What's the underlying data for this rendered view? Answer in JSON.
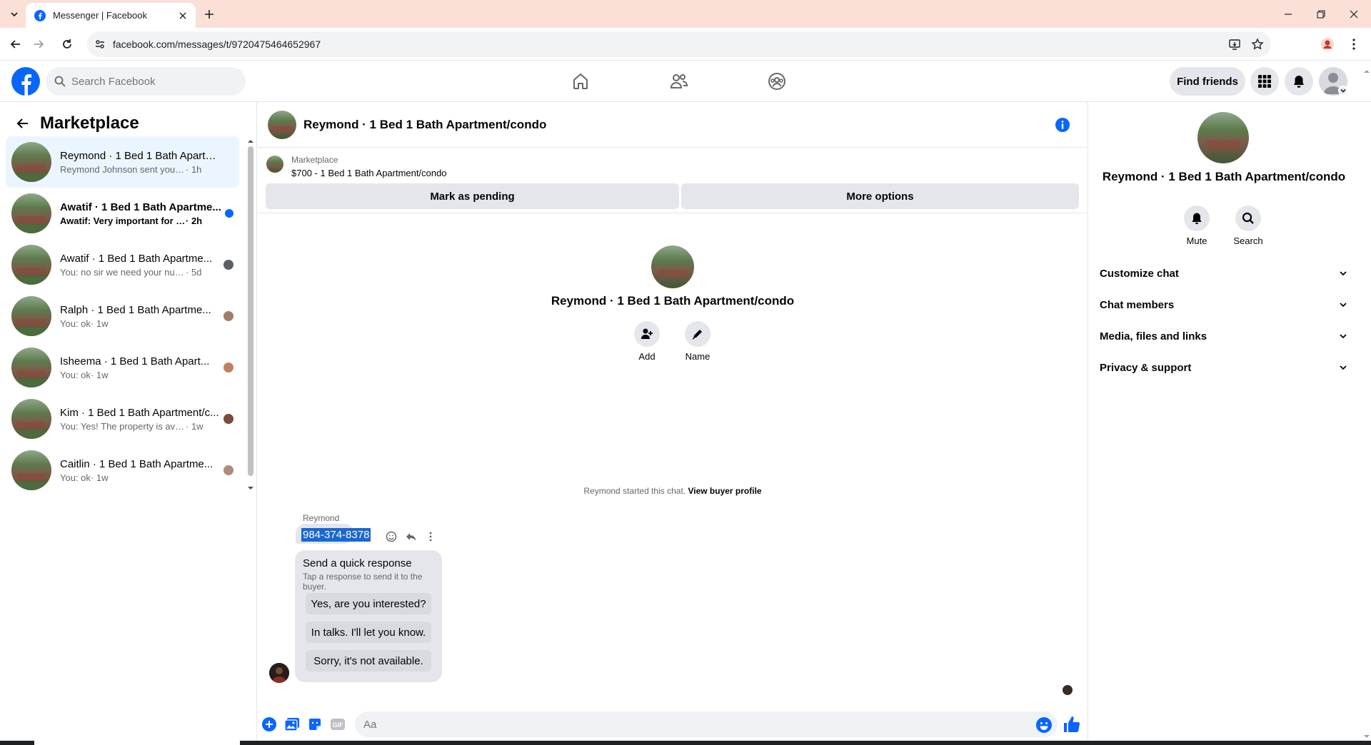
{
  "browser": {
    "tab_title": "Messenger | Facebook",
    "url": "facebook.com/messages/t/9720475464652967"
  },
  "header": {
    "search_placeholder": "Search Facebook",
    "find_friends": "Find friends"
  },
  "sidebar": {
    "title": "Marketplace",
    "conversations": [
      {
        "name": "Reymond · 1 Bed 1 Bath Apartm...",
        "snippet": "Reymond Johnson sent you a mess...",
        "time": " · 1h",
        "active": true,
        "unread": false
      },
      {
        "name": "Awatif · 1 Bed 1 Bath Apartme...",
        "snippet": "Awatif: Very important for me",
        "time": " · 2h",
        "active": false,
        "unread": true
      },
      {
        "name": "Awatif · 1 Bed 1 Bath Apartme...",
        "snippet": "You: no sir we need your numbe...",
        "time": " · 5d",
        "active": false,
        "unread": false
      },
      {
        "name": "Ralph · 1 Bed 1 Bath Apartme...",
        "snippet": "You: ok",
        "time": " · 1w",
        "active": false,
        "unread": false
      },
      {
        "name": "Isheema · 1 Bed 1 Bath Apart...",
        "snippet": "You: ok",
        "time": " · 1w",
        "active": false,
        "unread": false
      },
      {
        "name": "Kim · 1 Bed 1 Bath Apartment/c...",
        "snippet": "You: Yes! The property is available ...",
        "time": " · 1w",
        "active": false,
        "unread": false
      },
      {
        "name": "Caitlin · 1 Bed 1 Bath Apartme...",
        "snippet": "You: ok",
        "time": " · 1w",
        "active": false,
        "unread": false
      }
    ]
  },
  "chat": {
    "title": "Reymond · 1 Bed 1 Bath Apartment/condo",
    "marketplace_label": "Marketplace",
    "listing": "$700 - 1 Bed 1 Bath Apartment/condo",
    "mark_pending": "Mark as pending",
    "more_options": "More options",
    "intro_name": "Reymond · 1 Bed 1 Bath Apartment/condo",
    "add_label": "Add",
    "name_label": "Name",
    "started_text": "Reymond started this chat.",
    "view_profile": "View buyer profile",
    "sender": "Reymond",
    "message": "984-374-8378",
    "quick_title": "Send a quick response",
    "quick_sub": "Tap a response to send it to the buyer.",
    "quick_responses": [
      "Yes, are you interested?",
      "In talks. I'll let you know.",
      "Sorry, it's not available."
    ],
    "input_placeholder": "Aa"
  },
  "details": {
    "name": "Reymond · 1 Bed 1 Bath Apartment/condo",
    "mute_label": "Mute",
    "search_label": "Search",
    "sections": [
      "Customize chat",
      "Chat members",
      "Media, files and links",
      "Privacy & support"
    ]
  },
  "colors": {
    "brand_blue": "#0866ff",
    "active_conv_bg": "#ebf5ff",
    "button_gray": "#e4e6eb"
  }
}
